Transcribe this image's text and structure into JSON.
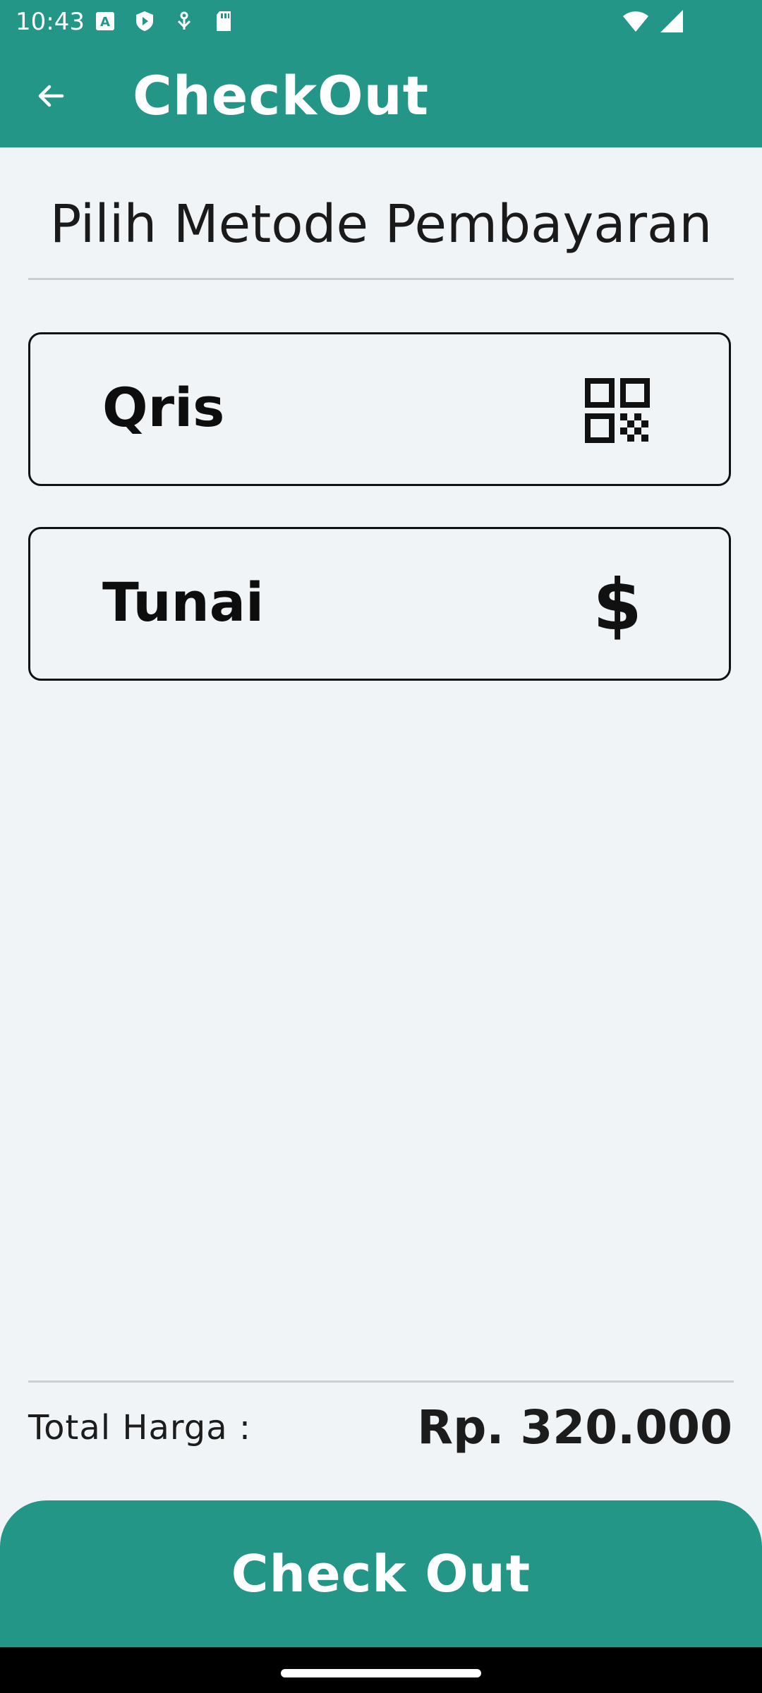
{
  "status_bar": {
    "time": "10:43",
    "left_icons": [
      "font-icon",
      "shield-icon",
      "usb-debug-icon",
      "sd-card-icon"
    ],
    "right_icons": [
      "wifi-icon",
      "signal-icon"
    ]
  },
  "app_bar": {
    "title": "CheckOut",
    "back_icon": "arrow-left-icon",
    "color": "#239687"
  },
  "section": {
    "title": "Pilih Metode Pembayaran"
  },
  "payment_methods": [
    {
      "label": "Qris",
      "icon": "qr-code-icon"
    },
    {
      "label": "Tunai",
      "icon": "dollar-icon",
      "glyph": "$"
    }
  ],
  "summary": {
    "total_label": "Total Harga :",
    "total_value": "Rp. 320.000"
  },
  "checkout_button": {
    "label": "Check Out"
  }
}
